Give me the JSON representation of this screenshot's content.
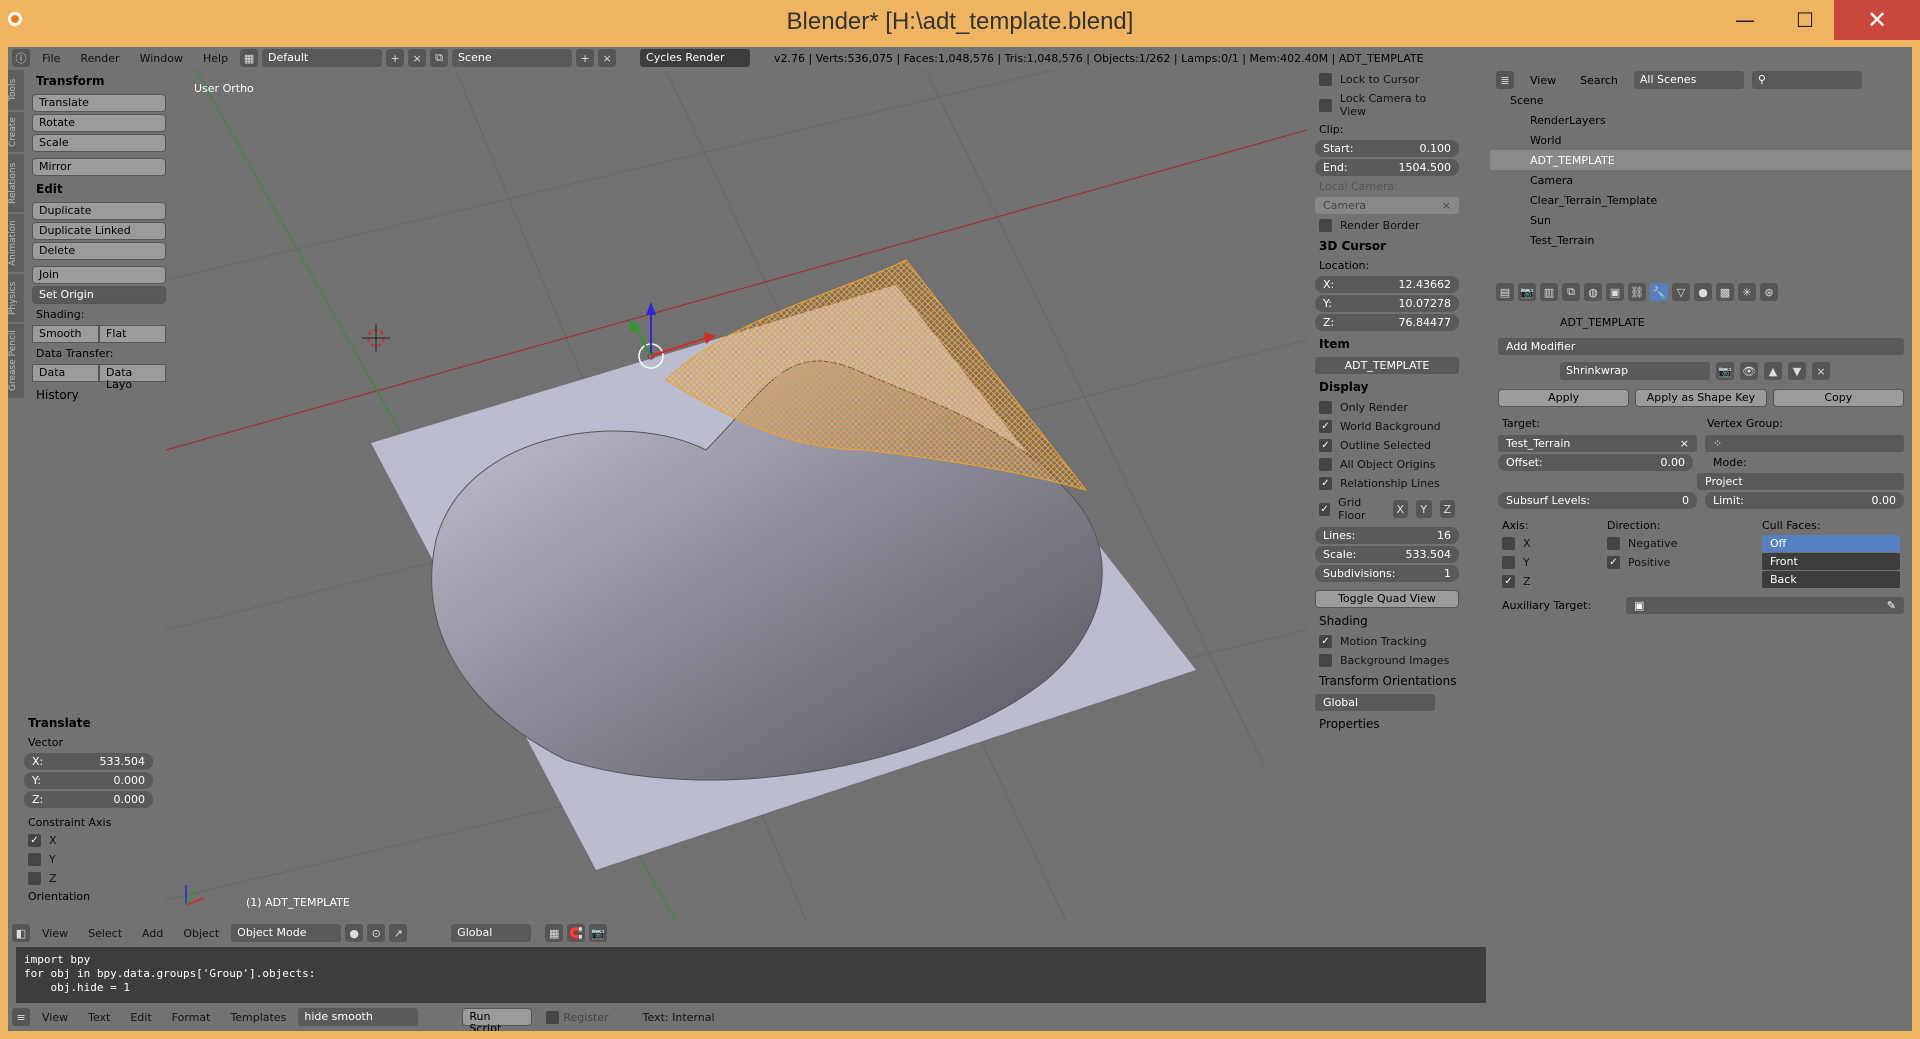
{
  "window": {
    "title": "Blender* [H:\\adt_template.blend]",
    "minimize": "—",
    "maximize": "☐",
    "close": "✕"
  },
  "info_header": {
    "menus": [
      "File",
      "Render",
      "Window",
      "Help"
    ],
    "layout": "Default",
    "scene": "Scene",
    "engine": "Cycles Render",
    "stats": "v2.76 | Verts:536,075 | Faces:1,048,576 | Tris:1,048,576 | Objects:1/262 | Lamps:0/1 | Mem:402.40M | ADT_TEMPLATE"
  },
  "tool_tabs": [
    "Tools",
    "Create",
    "Relations",
    "Animation",
    "Physics",
    "Grease Pencil"
  ],
  "tools": {
    "transform_label": "Transform",
    "translate": "Translate",
    "rotate": "Rotate",
    "scale": "Scale",
    "mirror": "Mirror",
    "edit_label": "Edit",
    "duplicate": "Duplicate",
    "duplicate_linked": "Duplicate Linked",
    "delete": "Delete",
    "join": "Join",
    "set_origin": "Set Origin",
    "shading_label": "Shading:",
    "smooth": "Smooth",
    "flat": "Flat",
    "data_transfer_label": "Data Transfer:",
    "data": "Data",
    "data_layo": "Data Layo",
    "history": "History"
  },
  "operator": {
    "title": "Translate",
    "vector_label": "Vector",
    "x": "X:",
    "x_val": "533.504",
    "y": "Y:",
    "y_val": "0.000",
    "z": "Z:",
    "z_val": "0.000",
    "constraint_label": "Constraint Axis",
    "cx": "X",
    "cy": "Y",
    "cz": "Z",
    "orientation": "Orientation"
  },
  "viewport": {
    "view_name": "User Ortho",
    "object_label": "(1) ADT_TEMPLATE"
  },
  "view3d_header": {
    "menus": [
      "View",
      "Select",
      "Add",
      "Object"
    ],
    "mode": "Object Mode",
    "orientation": "Global"
  },
  "npanel": {
    "lock_cursor": "Lock to Cursor",
    "lock_camera": "Lock Camera to View",
    "clip": "Clip:",
    "start": "Start:",
    "start_val": "0.100",
    "end": "End:",
    "end_val": "1504.500",
    "local_camera": "Local Camera:",
    "camera": "Camera",
    "render_border": "Render Border",
    "cursor_head": "3D Cursor",
    "location": "Location:",
    "cx": "X:",
    "cx_val": "12.43662",
    "cy": "Y:",
    "cy_val": "10.07278",
    "cz": "Z:",
    "cz_val": "76.84477",
    "item_head": "Item",
    "item_name": "ADT_TEMPLATE",
    "display_head": "Display",
    "only_render": "Only Render",
    "world_bg": "World Background",
    "outline_sel": "Outline Selected",
    "all_origins": "All Object Origins",
    "rel_lines": "Relationship Lines",
    "grid_floor": "Grid Floor",
    "gx": "X",
    "gy": "Y",
    "gz": "Z",
    "lines": "Lines:",
    "lines_val": "16",
    "scale": "Scale:",
    "scale_val": "533.504",
    "subdiv": "Subdivisions:",
    "subdiv_val": "1",
    "toggle_quad": "Toggle Quad View",
    "shading": "Shading",
    "motion": "Motion Tracking",
    "bg_images": "Background Images",
    "transform_orient": "Transform Orientations",
    "global": "Global",
    "properties": "Properties"
  },
  "outliner": {
    "view": "View",
    "search": "Search",
    "filter": "All Scenes",
    "items": [
      "Scene",
      "RenderLayers",
      "World",
      "ADT_TEMPLATE",
      "Camera",
      "Clear_Terrain_Template",
      "Sun",
      "Test_Terrain"
    ]
  },
  "modifier": {
    "object_name": "ADT_TEMPLATE",
    "add_modifier": "Add Modifier",
    "name": "Shrinkwrap",
    "apply": "Apply",
    "apply_shape": "Apply as Shape Key",
    "copy": "Copy",
    "target_label": "Target:",
    "target": "Test_Terrain",
    "vgroup_label": "Vertex Group:",
    "offset": "Offset:",
    "offset_val": "0.00",
    "mode_label": "Mode:",
    "mode": "Project",
    "subsurf": "Subsurf Levels:",
    "subsurf_val": "0",
    "limit": "Limit:",
    "limit_val": "0.00",
    "axis_label": "Axis:",
    "ax": "X",
    "ay": "Y",
    "az": "Z",
    "dir_label": "Direction:",
    "negative": "Negative",
    "positive": "Positive",
    "cull_label": "Cull Faces:",
    "cull_off": "Off",
    "cull_front": "Front",
    "cull_back": "Back",
    "aux_label": "Auxiliary Target:"
  },
  "text_editor": {
    "code": "import bpy\nfor obj in bpy.data.groups['Group'].objects:\n    obj.hide = 1"
  },
  "text_header": {
    "menus": [
      "View",
      "Text",
      "Edit",
      "Format",
      "Templates"
    ],
    "textname": "hide smooth",
    "run": "Run Script",
    "register": "Register",
    "internal": "Text: Internal"
  }
}
